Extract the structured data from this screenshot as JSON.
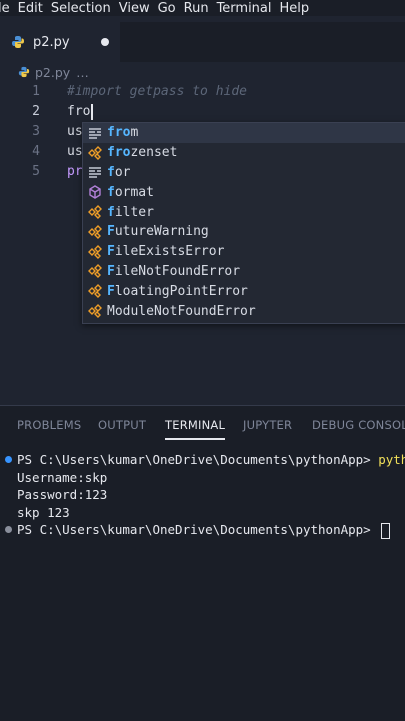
{
  "menu": [
    "le",
    "Edit",
    "Selection",
    "View",
    "Go",
    "Run",
    "Terminal",
    "Help"
  ],
  "tab": {
    "label": "p2.py"
  },
  "breadcrumb": {
    "file": "p2.py",
    "more": "…"
  },
  "editor": {
    "lines": [
      {
        "num": "1",
        "text": "#import getpass to hide"
      },
      {
        "num": "2",
        "text": "fro"
      },
      {
        "num": "3",
        "text": "us"
      },
      {
        "num": "4",
        "text": "us"
      },
      {
        "num": "5",
        "text": "pr"
      }
    ]
  },
  "suggestions": [
    {
      "match": "fro",
      "rest": "m",
      "kind": "keyword-icon"
    },
    {
      "match": "fro",
      "rest": "zenset",
      "kind": "class-icon"
    },
    {
      "match": "f",
      "rest": "or",
      "kind": "keyword-icon"
    },
    {
      "match": "f",
      "rest": "ormat",
      "kind": "function-icon"
    },
    {
      "match": "f",
      "rest": "ilter",
      "kind": "class-icon"
    },
    {
      "match": "F",
      "rest": "utureWarning",
      "kind": "class-icon"
    },
    {
      "match": "F",
      "rest": "ileExistsError",
      "kind": "class-icon"
    },
    {
      "match": "F",
      "rest": "ileNotFoundError",
      "kind": "class-icon"
    },
    {
      "match": "F",
      "rest": "loatingPointError",
      "kind": "class-icon"
    },
    {
      "match": "",
      "rest": "ModuleNotFoundError",
      "kind": "class-icon"
    }
  ],
  "panel": {
    "tabs": [
      "PROBLEMS",
      "OUTPUT",
      "TERMINAL",
      "JUPYTER",
      "DEBUG CONSOLE"
    ],
    "active_tab": "TERMINAL"
  },
  "terminal": {
    "prompt1": "PS C:\\Users\\kumar\\OneDrive\\Documents\\pythonApp> ",
    "cmd1": "python",
    "out1": "Username:skp",
    "out2": "Password:123",
    "out3": "skp 123",
    "prompt2": "PS C:\\Users\\kumar\\OneDrive\\Documents\\pythonApp> "
  },
  "colors": {
    "accent": "#56b6ff",
    "keyword": "#c59aff",
    "dot_blue": "#3794ff",
    "dot_gray": "#8a8f9c"
  }
}
